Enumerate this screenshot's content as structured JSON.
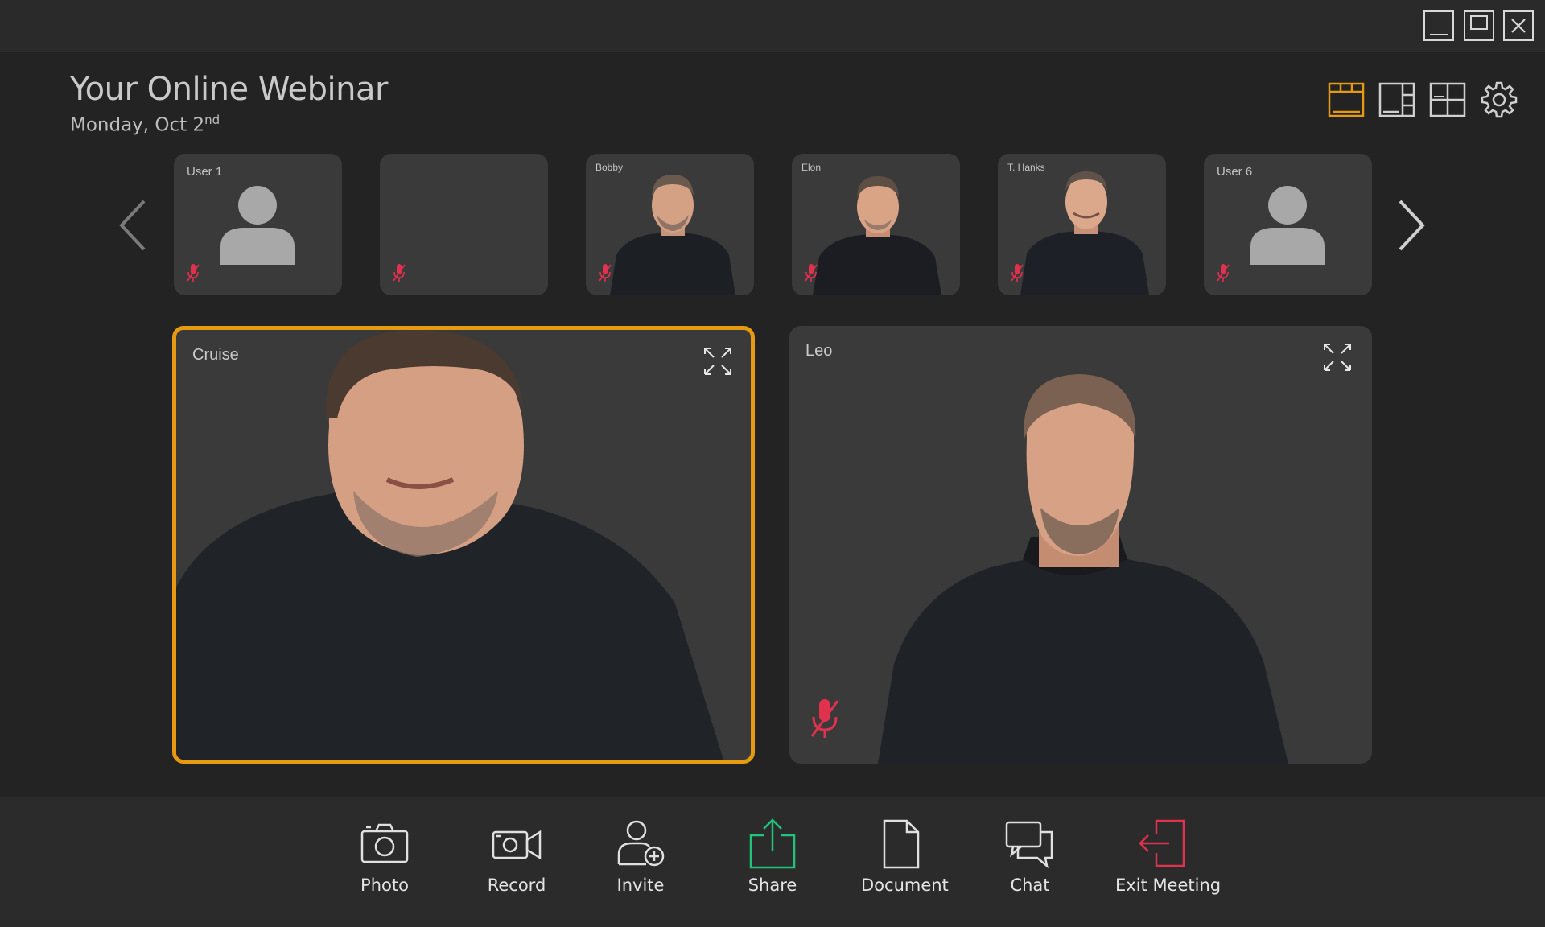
{
  "window": {
    "controls": [
      "minimize-icon",
      "maximize-icon",
      "close-icon"
    ]
  },
  "header": {
    "title": "Your Online Webinar",
    "date": "Monday, Oct 2",
    "date_suffix": "nd"
  },
  "colors": {
    "accent": "#e59a12",
    "muted_mic": "#e0314f",
    "share": "#21c37a",
    "exit": "#e0314f",
    "tile": "#3a3a3a",
    "background": "#232323"
  },
  "view_modes": [
    "layout-filmstrip-icon",
    "layout-sidebar-icon",
    "layout-grid-icon",
    "settings-gear-icon"
  ],
  "participants": [
    {
      "label": "User 1",
      "type": "avatar",
      "muted": true
    },
    {
      "label": "",
      "type": "empty",
      "muted": true
    },
    {
      "label": "Bobby",
      "type": "video",
      "muted": true
    },
    {
      "label": "Elon",
      "type": "video",
      "muted": true
    },
    {
      "label": "T. Hanks",
      "type": "video",
      "muted": true
    },
    {
      "label": "User 6",
      "type": "avatar",
      "muted": true
    }
  ],
  "stage": [
    {
      "label": "Cruise",
      "active": true,
      "muted": false
    },
    {
      "label": "Leo",
      "active": false,
      "muted": true
    }
  ],
  "toolbar": {
    "photo": "Photo",
    "record": "Record",
    "invite": "Invite",
    "share": "Share",
    "document": "Document",
    "chat": "Chat",
    "exit": "Exit Meeting"
  }
}
